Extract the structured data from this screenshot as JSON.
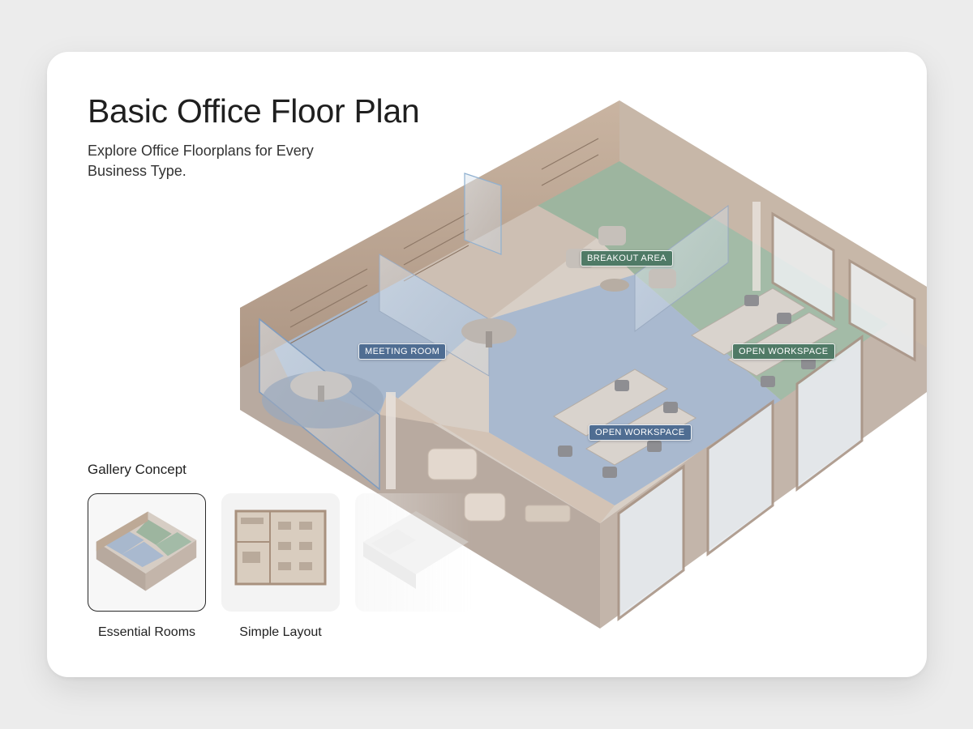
{
  "header": {
    "title": "Basic Office Floor Plan",
    "subtitle": "Explore Office Floorplans for Every Business Type."
  },
  "floor_plan": {
    "rooms": [
      {
        "id": "meeting",
        "label": "MEETING ROOM",
        "color": "#4f6d92"
      },
      {
        "id": "breakout",
        "label": "BREAKOUT AREA",
        "color": "#4f7a66"
      },
      {
        "id": "open-workspace-east",
        "label": "OPEN WORKSPACE",
        "color": "#4f7a66"
      },
      {
        "id": "open-workspace-south",
        "label": "OPEN WORKSPACE",
        "color": "#4f6d92"
      }
    ]
  },
  "gallery": {
    "heading": "Gallery Concept",
    "items": [
      {
        "caption": "Essential Rooms",
        "selected": true
      },
      {
        "caption": "Simple Layout",
        "selected": false
      },
      {
        "caption": "",
        "selected": false
      }
    ]
  },
  "colors": {
    "card_background": "#ffffff",
    "page_background": "#ececec",
    "blue_floor": "#a9b9cf",
    "green_floor": "#9fb7a5",
    "wood": "#c7b3a1",
    "wall": "#b9aba0"
  }
}
